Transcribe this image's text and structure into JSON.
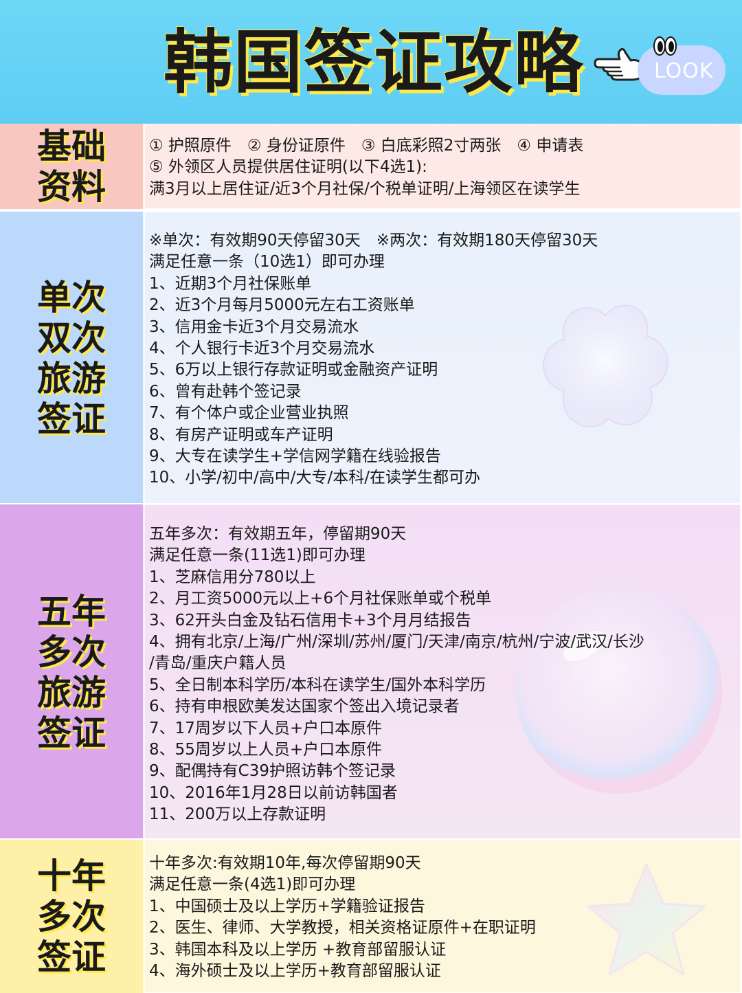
{
  "header": {
    "title": "韩国签证攻略",
    "logo_text": "LOOK"
  },
  "sections": {
    "basic": {
      "label": "基础资料",
      "lines": [
        "① 护照原件　② 身份证原件　③ 白底彩照2寸两张　④ 申请表",
        "⑤ 外领区人员提供居住证明(以下4选1):",
        "满3月以上居住证/近3个月社保/个税单证明/上海领区在读学生"
      ]
    },
    "single": {
      "label": "单次双次旅游签证",
      "lines": [
        "※单次：有效期90天停留30天　※两次：有效期180天停留30天",
        "满足任意一条（10选1）即可办理",
        "1、近期3个月社保账单",
        "2、近3个月每月5000元左右工资账单",
        "3、信用金卡近3个月交易流水",
        "4、个人银行卡近3个月交易流水",
        "5、6万以上银行存款证明或金融资产证明",
        "6、曾有赴韩个签记录",
        "7、有个体户或企业营业执照",
        "8、有房产证明或车产证明",
        "9、大专在读学生+学信网学籍在线验报告",
        "10、小学/初中/高中/大专/本科/在读学生都可办"
      ]
    },
    "five": {
      "label": "五年多次旅游签证",
      "lines": [
        "五年多次：有效期五年，停留期90天",
        "满足任意一条(11选1)即可办理",
        "1、芝麻信用分780以上",
        "2、月工资5000元以上+6个月社保账单或个税单",
        "3、62开头白金及钻石信用卡+3个月月结报告",
        "4、拥有北京/上海/广州/深圳/苏州/厦门/天津/南京/杭州/宁波/武汉/长沙",
        "/青岛/重庆户籍人员",
        "5、全日制本科学历/本科在读学生/国外本科学历",
        "6、持有申根欧美发达国家个签出入境记录者",
        "7、17周岁以下人员+户口本原件",
        "8、55周岁以上人员+户口本原件",
        "9、配偶持有C39护照访韩个签记录",
        "10、2016年1月28日以前访韩国者",
        "11、200万以上存款证明"
      ]
    },
    "ten": {
      "label": "十年多次签证",
      "lines": [
        "十年多次:有效期10年,每次停留期90天",
        "满足任意一条(4选1)即可办理",
        "1、中国硕士及以上学历+学籍验证报告",
        "2、医生、律师、大学教授，相关资格证原件+在职证明",
        "3、韩国本科及以上学历 +教育部留服认证",
        "4、海外硕士及以上学历+教育部留服认证"
      ]
    }
  },
  "colors": {
    "header_bg": "#6dd7f7",
    "title_shadow": "#ffe94a",
    "basic_label_bg": "#f7c7c0",
    "single_label_bg": "#bcd9fb",
    "five_label_bg": "#dba7ea",
    "ten_label_bg": "#fff0a8"
  },
  "icons": [
    "pointing-hand-icon",
    "look-logo"
  ]
}
